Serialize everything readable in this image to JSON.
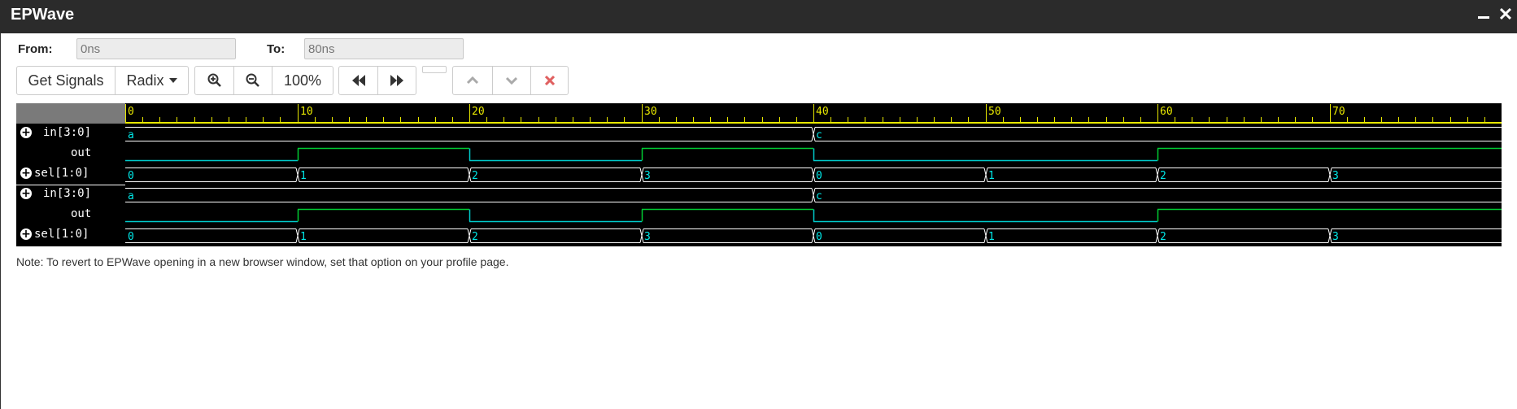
{
  "window": {
    "title": "EPWave"
  },
  "range": {
    "from_label": "From:",
    "from_value": "0ns",
    "to_label": "To:",
    "to_value": "80ns"
  },
  "toolbar": {
    "get_signals": "Get Signals",
    "radix": "Radix",
    "zoom_in_icon": "zoom-in-icon",
    "zoom_out_icon": "zoom-out-icon",
    "zoom_level": "100%",
    "prev_icon": "rewind-icon",
    "next_icon": "fast-forward-icon",
    "up_icon": "chevron-up-icon",
    "down_icon": "chevron-down-icon",
    "remove_icon": "close-icon"
  },
  "timeline": {
    "unit_max": 80,
    "tick_labels": [
      "0",
      "10",
      "20",
      "30",
      "40",
      "50",
      "60",
      "70"
    ]
  },
  "signals": [
    {
      "name": "in[3:0]",
      "expandable": true,
      "type": "bus",
      "transitions": [
        [
          0,
          "a"
        ],
        [
          40,
          "c"
        ]
      ]
    },
    {
      "name": "out",
      "expandable": false,
      "type": "bit",
      "transitions": [
        [
          0,
          0
        ],
        [
          10,
          1
        ],
        [
          20,
          0
        ],
        [
          30,
          1
        ],
        [
          40,
          0
        ],
        [
          60,
          1
        ]
      ]
    },
    {
      "name": "sel[1:0]",
      "expandable": true,
      "type": "bus",
      "transitions": [
        [
          0,
          "0"
        ],
        [
          10,
          "1"
        ],
        [
          20,
          "2"
        ],
        [
          30,
          "3"
        ],
        [
          40,
          "0"
        ],
        [
          50,
          "1"
        ],
        [
          60,
          "2"
        ],
        [
          70,
          "3"
        ]
      ]
    },
    {
      "name": "in[3:0]",
      "expandable": true,
      "type": "bus",
      "transitions": [
        [
          0,
          "a"
        ],
        [
          40,
          "c"
        ]
      ]
    },
    {
      "name": "out",
      "expandable": false,
      "type": "bit",
      "transitions": [
        [
          0,
          0
        ],
        [
          10,
          1
        ],
        [
          20,
          0
        ],
        [
          30,
          1
        ],
        [
          40,
          0
        ],
        [
          60,
          1
        ]
      ]
    },
    {
      "name": "sel[1:0]",
      "expandable": true,
      "type": "bus",
      "transitions": [
        [
          0,
          "0"
        ],
        [
          10,
          "1"
        ],
        [
          20,
          "2"
        ],
        [
          30,
          "3"
        ],
        [
          40,
          "0"
        ],
        [
          50,
          "1"
        ],
        [
          60,
          "2"
        ],
        [
          70,
          "3"
        ]
      ]
    }
  ],
  "colors": {
    "bus": "#ffffff",
    "bus_text": "#00e8e8",
    "bit_high": "#00cc33",
    "bit_low": "#00cccc",
    "ruler": "#e8e800"
  },
  "note": "Note: To revert to EPWave opening in a new browser window, set that option on your profile page."
}
